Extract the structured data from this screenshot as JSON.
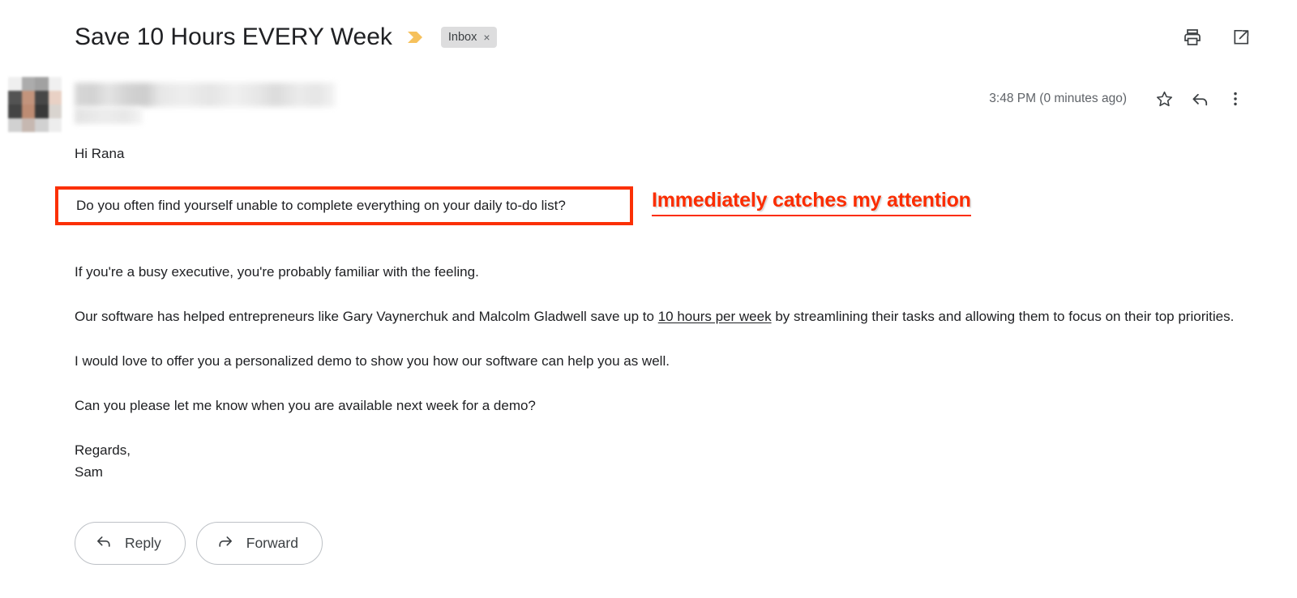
{
  "header": {
    "subject": "Save 10 Hours EVERY Week",
    "important_marker_icon": "yellow-chevron-icon",
    "label_chip": "Inbox",
    "label_chip_remove": "×",
    "print_icon": "print-icon",
    "open_new_window_icon": "open-in-new-window-icon"
  },
  "sender": {
    "name_redacted": "",
    "email_redacted": "",
    "avatar_icon": "pixelated-avatar",
    "timestamp": "3:48 PM (0 minutes ago)",
    "star_icon": "star-icon",
    "reply_icon": "reply-arrow-icon",
    "more_icon": "more-options-icon"
  },
  "message": {
    "greeting": "Hi Rana",
    "highlighted_question": "Do you often find yourself unable to complete everything on your daily to-do list?",
    "paragraph_1": "If you're a busy executive, you're probably familiar with the feeling.",
    "paragraph_2_part1": "Our software has helped entrepreneurs like Gary Vaynerchuk and Malcolm Gladwell save up to ",
    "paragraph_2_underlined": "10 hours per week",
    "paragraph_2_part2": " by streamlining their tasks and allowing them to focus on their top priorities.",
    "paragraph_3": "I would love to offer you a personalized demo to show you how our software can help you as well.",
    "paragraph_4": "Can you please let me know when you are available next week for a demo?",
    "signoff": "Regards,",
    "signature": "Sam"
  },
  "annotation": {
    "text": "Immediately catches my attention",
    "color": "#fb2d00",
    "box_border_color": "#fb3005"
  },
  "actions": {
    "reply_label": "Reply",
    "reply_icon": "reply-arrow-icon",
    "forward_label": "Forward",
    "forward_icon": "forward-arrow-icon"
  }
}
